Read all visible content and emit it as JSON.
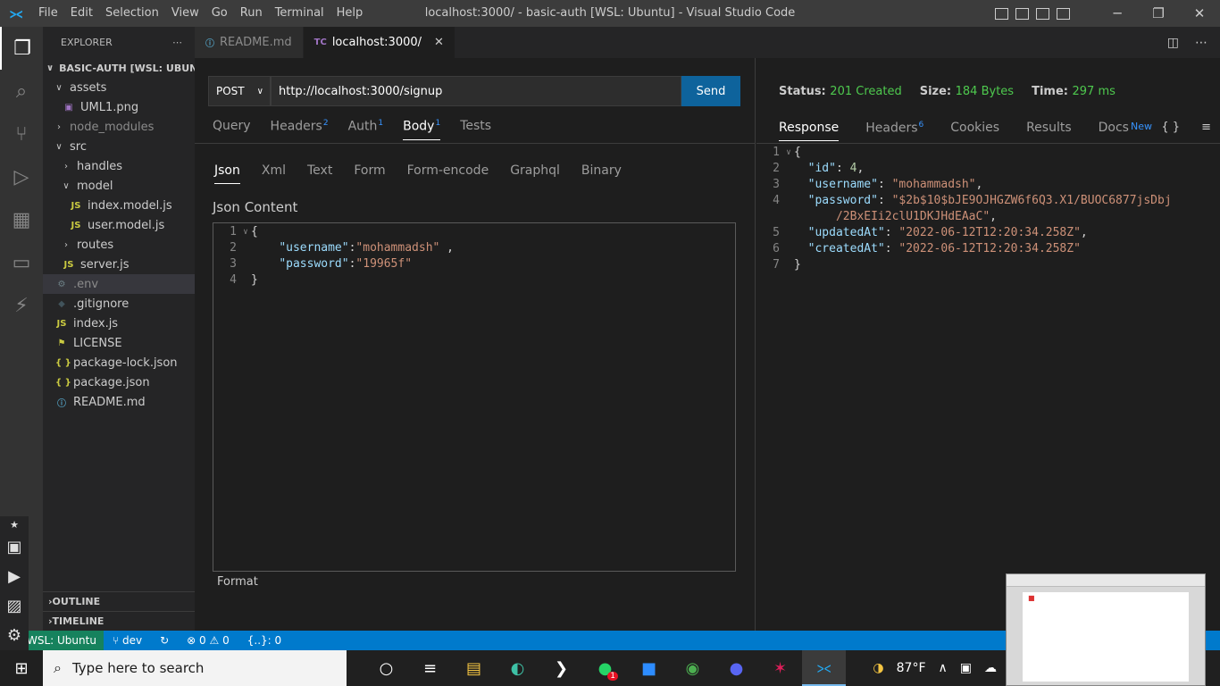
{
  "titlebar": {
    "menu": [
      "File",
      "Edit",
      "Selection",
      "View",
      "Go",
      "Run",
      "Terminal",
      "Help"
    ],
    "title": "localhost:3000/ - basic-auth [WSL: Ubuntu] - Visual Studio Code"
  },
  "sidebar": {
    "header": "EXPLORER",
    "root": "BASIC-AUTH [WSL: UBUN...",
    "tree": [
      {
        "label": "assets",
        "kind": "folder-open",
        "depth": 1
      },
      {
        "label": "UML1.png",
        "kind": "image",
        "depth": 2
      },
      {
        "label": "node_modules",
        "kind": "folder",
        "depth": 1
      },
      {
        "label": "src",
        "kind": "folder-open",
        "depth": 1
      },
      {
        "label": "handles",
        "kind": "folder",
        "depth": 2
      },
      {
        "label": "model",
        "kind": "folder-open",
        "depth": 2
      },
      {
        "label": "index.model.js",
        "kind": "js",
        "depth": 3
      },
      {
        "label": "user.model.js",
        "kind": "js",
        "depth": 3
      },
      {
        "label": "routes",
        "kind": "folder",
        "depth": 2
      },
      {
        "label": "server.js",
        "kind": "js",
        "depth": 2
      },
      {
        "label": ".env",
        "kind": "gear",
        "depth": 1
      },
      {
        "label": ".gitignore",
        "kind": "git",
        "depth": 1
      },
      {
        "label": "index.js",
        "kind": "js",
        "depth": 1
      },
      {
        "label": "LICENSE",
        "kind": "license",
        "depth": 1
      },
      {
        "label": "package-lock.json",
        "kind": "json",
        "depth": 1
      },
      {
        "label": "package.json",
        "kind": "json",
        "depth": 1
      },
      {
        "label": "README.md",
        "kind": "info",
        "depth": 1
      }
    ],
    "outline": "OUTLINE",
    "timeline": "TIMELINE"
  },
  "tabs": [
    {
      "icon": "info-icon",
      "label": "README.md",
      "active": false
    },
    {
      "icon": "TC",
      "label": "localhost:3000/",
      "active": true
    }
  ],
  "request": {
    "method": "POST",
    "url": "http://localhost:3000/signup",
    "send": "Send",
    "tabs": [
      {
        "label": "Query",
        "count": ""
      },
      {
        "label": "Headers",
        "count": "2"
      },
      {
        "label": "Auth",
        "count": "1"
      },
      {
        "label": "Body",
        "count": "1"
      },
      {
        "label": "Tests",
        "count": ""
      }
    ],
    "body_tabs": [
      "Json",
      "Xml",
      "Text",
      "Form",
      "Form-encode",
      "Graphql",
      "Binary"
    ],
    "json_label": "Json Content",
    "format": "Format",
    "body_lines": [
      "1",
      "2",
      "3",
      "4"
    ],
    "username_key": "\"username\"",
    "username_val": "\"mohammadsh\"",
    "password_key": "\"password\"",
    "password_val": "\"19965f\""
  },
  "response": {
    "status_label": "Status:",
    "status": "201 Created",
    "size_label": "Size:",
    "size": "184 Bytes",
    "time_label": "Time:",
    "time": "297 ms",
    "tabs": [
      {
        "label": "Response",
        "count": ""
      },
      {
        "label": "Headers",
        "count": "6"
      },
      {
        "label": "Cookies",
        "count": ""
      },
      {
        "label": "Results",
        "count": ""
      },
      {
        "label": "Docs",
        "count": "New"
      }
    ],
    "id_key": "\"id\"",
    "id_val": "4",
    "username_key": "\"username\"",
    "username_val": "\"mohammadsh\"",
    "password_key": "\"password\"",
    "password_val_1": "\"$2b$10$bJE9OJHGZW6f6Q3.X1/BUOC6877jsDbj",
    "password_val_2": "/2BxEIi2clU1DKJHdEAaC\"",
    "updated_key": "\"updatedAt\"",
    "updated_val": "\"2022-06-12T12:20:34.258Z\"",
    "created_key": "\"createdAt\"",
    "created_val": "\"2022-06-12T12:20:34.258Z\""
  },
  "statusbar": {
    "remote": "WSL: Ubuntu",
    "branch": "dev",
    "errors": "0",
    "warnings": "0",
    "cursor": "{..}: 0"
  },
  "taskbar": {
    "search_placeholder": "Type here to search",
    "temperature": "87°F",
    "whatsapp_badge": "1"
  },
  "colors": {
    "accent": "#007acc",
    "send_button": "#0e639c",
    "status_ok": "#4ec94e",
    "remote": "#16825d"
  }
}
